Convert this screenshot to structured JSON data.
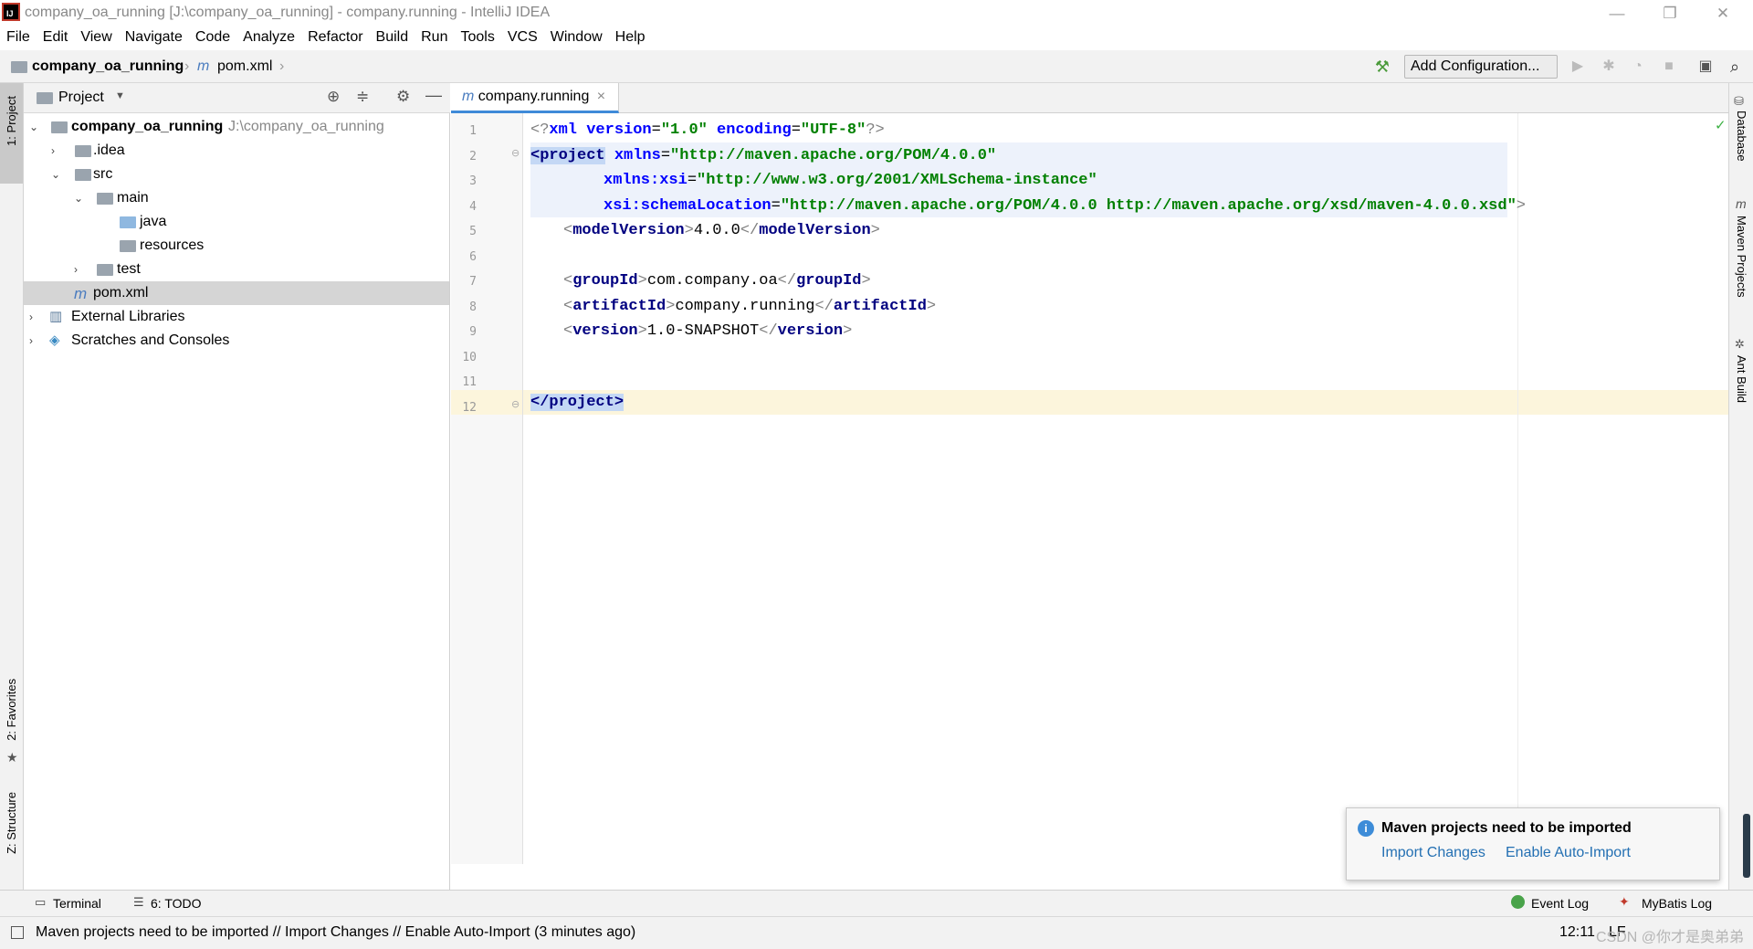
{
  "window": {
    "title": "company_oa_running [J:\\company_oa_running] - company.running - IntelliJ IDEA",
    "minimize": "—",
    "restore": "❐",
    "close": "✕"
  },
  "menu": [
    "File",
    "Edit",
    "View",
    "Navigate",
    "Code",
    "Analyze",
    "Refactor",
    "Build",
    "Run",
    "Tools",
    "VCS",
    "Window",
    "Help"
  ],
  "breadcrumb": {
    "project": "company_oa_running",
    "file_icon": "m",
    "file": "pom.xml"
  },
  "toolbar": {
    "add_configuration": "Add Configuration..."
  },
  "left_tabs": {
    "project": "1: Project",
    "favorites": "2: Favorites",
    "structure": "Z: Structure"
  },
  "right_tabs": {
    "database": "Database",
    "maven": "Maven Projects",
    "ant": "Ant Build"
  },
  "project_panel": {
    "title": "Project",
    "tree": [
      {
        "label": "company_oa_running",
        "path": "J:\\company_oa_running"
      },
      {
        "label": ".idea"
      },
      {
        "label": "src"
      },
      {
        "label": "main"
      },
      {
        "label": "java"
      },
      {
        "label": "resources"
      },
      {
        "label": "test"
      },
      {
        "label": "pom.xml"
      },
      {
        "label": "External Libraries"
      },
      {
        "label": "Scratches and Consoles"
      }
    ]
  },
  "editor": {
    "tab_label": "company.running",
    "tab_close": "×",
    "line_numbers": [
      "1",
      "2",
      "3",
      "4",
      "5",
      "6",
      "7",
      "8",
      "9",
      "10",
      "11",
      "12"
    ],
    "lines": [
      {
        "pre": "<?",
        "tag": "xml",
        "rest": " version=\"1.0\" encoding=\"UTF-8\"?>"
      },
      {
        "text": "<project xmlns=\"http://maven.apache.org/POM/4.0.0\""
      },
      {
        "text": "         xmlns:xsi=\"http://www.w3.org/2001/XMLSchema-instance\""
      },
      {
        "text": "         xsi:schemaLocation=\"http://maven.apache.org/POM/4.0.0 http://maven.apache.org/xsd/maven-4.0.0.xsd\">"
      },
      {
        "open": "modelVersion",
        "value": "4.0.0"
      },
      {
        "empty": ""
      },
      {
        "open": "groupId",
        "value": "com.company.oa"
      },
      {
        "open": "artifactId",
        "value": "company.running"
      },
      {
        "open": "version",
        "value": "1.0-SNAPSHOT"
      },
      {
        "empty": ""
      },
      {
        "empty": ""
      },
      {
        "close": "project"
      }
    ],
    "l1_a": "<?",
    "l1_tag": "xml",
    "l1_attr1": " version",
    "l1_eq": "=",
    "l1_val1": "\"1.0\"",
    "l1_attr2": " encoding",
    "l1_val2": "\"UTF-8\"",
    "l1_end": "?>",
    "l2_lt": "<",
    "l2_tag": "project",
    "l2_attr": " xmlns",
    "l2_val": "\"http://maven.apache.org/POM/4.0.0\"",
    "l3_attr": "xmlns:xsi",
    "l3_val": "\"http://www.w3.org/2001/XMLSchema-instance\"",
    "l4_attr": "xsi:schemaLocation",
    "l4_val": "\"http://maven.apache.org/POM/4.0.0 http://maven.apache.org/xsd/maven-4.0.0.xsd\"",
    "l4_gt": ">",
    "l5_tag": "modelVersion",
    "l5_val": "4.0.0",
    "l7_tag": "groupId",
    "l7_val": "com.company.oa",
    "l8_tag": "artifactId",
    "l8_val": "company.running",
    "l9_tag": "version",
    "l9_val": "1.0-SNAPSHOT",
    "l12_tag": "</project>"
  },
  "notification": {
    "title": "Maven projects need to be imported",
    "import_changes": "Import Changes",
    "enable_auto_import": "Enable Auto-Import"
  },
  "bottom_tools": {
    "terminal": "Terminal",
    "todo": "6: TODO",
    "event_log": "Event Log",
    "mybatis_log": "MyBatis Log"
  },
  "status": {
    "message": "Maven projects need to be imported // Import Changes // Enable Auto-Import (3 minutes ago)",
    "position": "12:11",
    "line_sep": "LF",
    "watermark": "CSDN @你才是奥弟弟"
  },
  "colors": {
    "tag": "#000080",
    "attribute": "#0000ff",
    "string": "#008000",
    "link": "#2470b3",
    "selection": "#d5d5d5",
    "tab_underline": "#3f8ad8"
  }
}
